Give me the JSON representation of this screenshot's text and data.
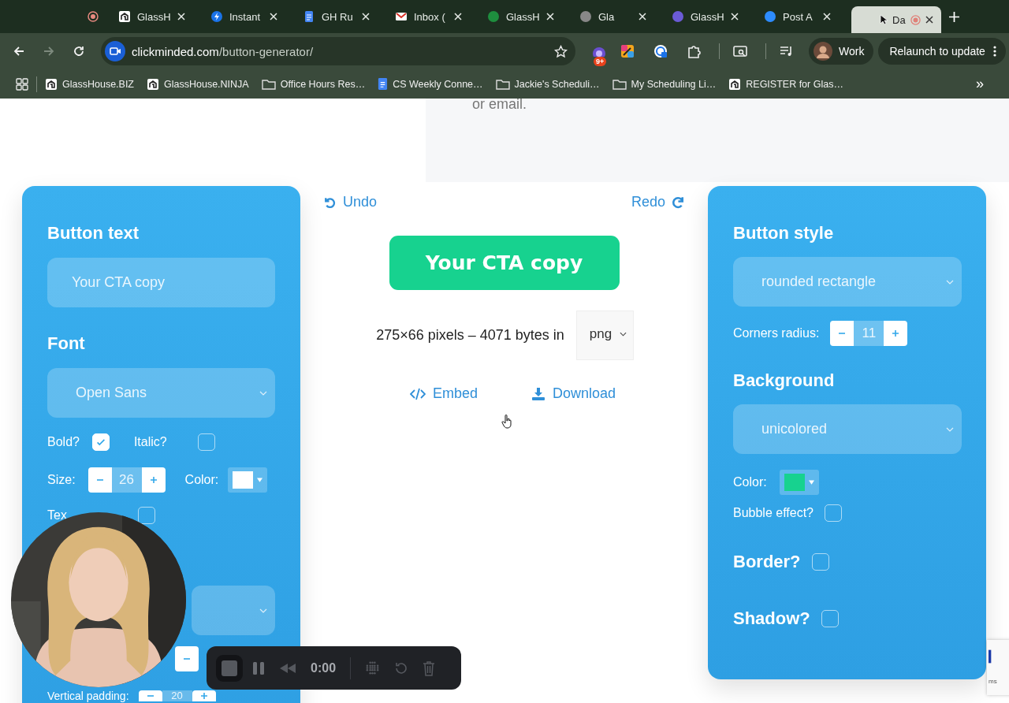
{
  "browser": {
    "tabs": [
      {
        "label": "GlassH",
        "selected": false
      },
      {
        "label": "Instant",
        "selected": false
      },
      {
        "label": "GH Ru",
        "selected": false
      },
      {
        "label": "Inbox (",
        "selected": false
      },
      {
        "label": "GlassH",
        "selected": false
      },
      {
        "label": "Gla",
        "selected": false
      },
      {
        "label": "GlassH",
        "selected": false
      },
      {
        "label": "Post A",
        "selected": false
      },
      {
        "label": "Da",
        "selected": true
      }
    ],
    "nav": {
      "back_disabled": false,
      "forward_disabled": true
    },
    "address": {
      "domain": "clickminded.com",
      "path": "/button-generator/"
    },
    "extension_badge": "9+",
    "profile": "Work",
    "relaunch": "Relaunch to update",
    "bookmarks": [
      {
        "label": "GlassHouse.BIZ",
        "kind": "site"
      },
      {
        "label": "GlassHouse.NINJA",
        "kind": "site"
      },
      {
        "label": "Office Hours Res…",
        "kind": "folder"
      },
      {
        "label": "CS Weekly Conne…",
        "kind": "doc"
      },
      {
        "label": "Jackie's Scheduli…",
        "kind": "folder"
      },
      {
        "label": "My Scheduling Li…",
        "kind": "folder"
      },
      {
        "label": "REGISTER for Glas…",
        "kind": "site"
      }
    ],
    "bookmarks_more": "»"
  },
  "hero_text": "or email.",
  "left_panel": {
    "button_text": {
      "heading": "Button text",
      "value": "Your CTA copy"
    },
    "font": {
      "heading": "Font",
      "value": "Open Sans"
    },
    "bold": {
      "label": "Bold?",
      "checked": true
    },
    "italic": {
      "label": "Italic?",
      "checked": false
    },
    "size": {
      "label": "Size:",
      "value": "26"
    },
    "color": {
      "label": "Color:",
      "color": "#ffffff"
    },
    "partial_option": {
      "label": "Tex",
      "checked": false
    },
    "vertical_padding": {
      "label": "Vertical padding:",
      "value": "20"
    }
  },
  "center": {
    "undo": "Undo",
    "redo": "Redo",
    "preview": "Your CTA copy",
    "info": "275×66 pixels – 4071 bytes in",
    "format": "png",
    "embed": "Embed",
    "download": "Download"
  },
  "right_panel": {
    "style": {
      "heading": "Button style",
      "value": "rounded rectangle"
    },
    "radius": {
      "label": "Corners radius:",
      "value": "11"
    },
    "background": {
      "heading": "Background",
      "value": "unicolored"
    },
    "color": {
      "label": "Color:",
      "color": "#17d28f"
    },
    "bubble": {
      "label": "Bubble effect?",
      "checked": false
    },
    "border": {
      "label": "Border?",
      "checked": false
    },
    "shadow": {
      "label": "Shadow?",
      "checked": false
    }
  },
  "recorder": {
    "time": "0:00"
  },
  "recaptcha": "ms"
}
